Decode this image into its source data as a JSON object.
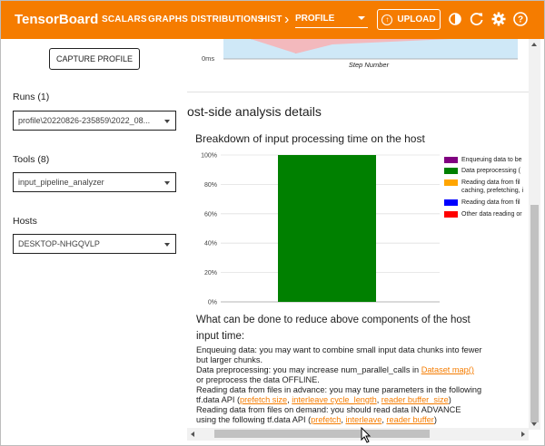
{
  "topbar": {
    "brand": "TensorBoard",
    "nav_items": [
      "SCALARS",
      "GRAPHS",
      "DISTRIBUTIONS",
      "HIST"
    ],
    "plugin_select": "PROFILE",
    "upload_label": "UPLOAD",
    "icons": [
      "dark-mode-icon",
      "refresh-icon",
      "settings-icon",
      "help-icon"
    ]
  },
  "sidebar": {
    "capture_label": "CAPTURE PROFILE",
    "runs_label": "Runs (1)",
    "runs_value": "profile\\20220826-235859\\2022_08...",
    "tools_label": "Tools (8)",
    "tools_value": "input_pipeline_analyzer",
    "hosts_label": "Hosts",
    "hosts_value": "DESKTOP-NHGQVLP"
  },
  "top_chart": {
    "tick_label": "0ms",
    "xlabel": "Step Number"
  },
  "main": {
    "section_title": "ost-side analysis details",
    "chart_title": "Breakdown of input processing time on the host",
    "question_line1": "What can be done to reduce above components of the host",
    "question_line2": "input time:",
    "advice": {
      "enqueue_1": "Enqueuing data: you may want to combine small input data chunks into fewer",
      "enqueue_2": "but larger chunks.",
      "preprocess_1": "Data preprocessing: you may increase num_parallel_calls in ",
      "preprocess_link": "Dataset map()",
      "preprocess_2": "or preprocess the data OFFLINE.",
      "advance_1": "Reading data from files in advance: you may tune parameters in the following",
      "advance_2": "tf.data API (",
      "advance_links": [
        "prefetch size",
        "interleave cycle_length",
        "reader buffer_size"
      ],
      "demand_1": "Reading data from files on demand: you should read data IN ADVANCE",
      "demand_2": "using the following tf.data API (",
      "demand_links": [
        "prefetch",
        "interleave",
        "reader buffer"
      ]
    }
  },
  "chart_data": {
    "type": "bar",
    "title": "Breakdown of input processing time on the host",
    "yticks": [
      "0%",
      "20%",
      "40%",
      "60%",
      "80%",
      "100%"
    ],
    "ylim": [
      0,
      100
    ],
    "stacked": true,
    "series": [
      {
        "name": "Enqueuing data to be",
        "color": "#800080",
        "values": [
          0
        ]
      },
      {
        "name": "Data preprocessing (",
        "color": "#008000",
        "values": [
          100
        ]
      },
      {
        "name": "Reading data from fil caching, prefetching, i",
        "color": "#ffa500",
        "values": [
          0
        ]
      },
      {
        "name": "Reading data from fil",
        "color": "#0000ff",
        "values": [
          0
        ]
      },
      {
        "name": "Other data reading or",
        "color": "#ff0000",
        "values": [
          0
        ]
      }
    ]
  }
}
